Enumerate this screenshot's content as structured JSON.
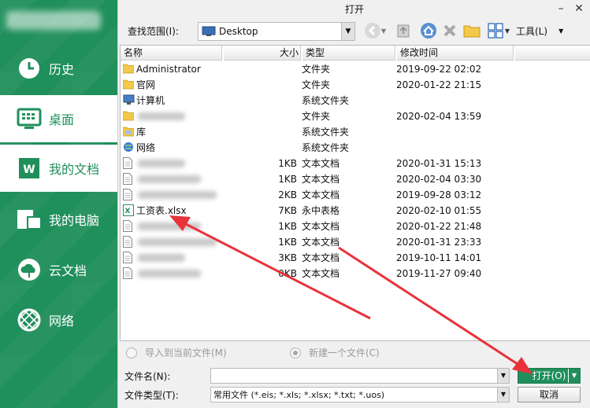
{
  "sidebar": {
    "items": [
      {
        "label": "历史",
        "icon": "clock-icon"
      },
      {
        "label": "桌面",
        "icon": "desktop-icon"
      },
      {
        "label": "我的文档",
        "icon": "documents-icon"
      },
      {
        "label": "我的电脑",
        "icon": "computer-icon"
      },
      {
        "label": "云文档",
        "icon": "cloud-icon"
      },
      {
        "label": "网络",
        "icon": "globe-icon"
      }
    ],
    "active_index": 1
  },
  "dialog": {
    "title": "打开",
    "look_in_label": "查找范围(I):",
    "look_in_value": "Desktop",
    "tools_label": "工具(L)"
  },
  "columns": {
    "name": "名称",
    "size": "大小",
    "type": "类型",
    "date": "修改时间"
  },
  "files": [
    {
      "name": "Administrator",
      "size": "",
      "type": "文件夹",
      "date": "2019-09-22 02:02",
      "icon": "folder-icon"
    },
    {
      "name": "官网",
      "size": "",
      "type": "文件夹",
      "date": "2020-01-22 21:15",
      "icon": "folder-icon"
    },
    {
      "name": "计算机",
      "size": "",
      "type": "系统文件夹",
      "date": "",
      "icon": "computer-icon"
    },
    {
      "name": "",
      "size": "",
      "type": "文件夹",
      "date": "2020-02-04 13:59",
      "icon": "folder-icon",
      "blurred": true
    },
    {
      "name": "库",
      "size": "",
      "type": "系统文件夹",
      "date": "",
      "icon": "library-icon"
    },
    {
      "name": "网络",
      "size": "",
      "type": "系统文件夹",
      "date": "",
      "icon": "network-icon"
    },
    {
      "name": "",
      "size": "1KB",
      "type": "文本文档",
      "date": "2020-01-31 15:13",
      "icon": "text-file-icon",
      "blurred": true
    },
    {
      "name": "",
      "size": "1KB",
      "type": "文本文档",
      "date": "2020-02-04 03:30",
      "icon": "text-file-icon",
      "blurred": true
    },
    {
      "name": "",
      "size": "2KB",
      "type": "文本文档",
      "date": "2019-09-28 03:12",
      "icon": "text-file-icon",
      "blurred": true
    },
    {
      "name": "工资表.xlsx",
      "size": "7KB",
      "type": "永中表格",
      "date": "2020-02-10 01:55",
      "icon": "spreadsheet-icon"
    },
    {
      "name": "",
      "size": "1KB",
      "type": "文本文档",
      "date": "2020-01-22 21:48",
      "icon": "text-file-icon",
      "blurred": true
    },
    {
      "name": "",
      "size": "1KB",
      "type": "文本文档",
      "date": "2020-01-31 23:33",
      "icon": "text-file-icon",
      "blurred": true
    },
    {
      "name": "",
      "size": "3KB",
      "type": "文本文档",
      "date": "2019-10-11 14:01",
      "icon": "text-file-icon",
      "blurred": true
    },
    {
      "name": "",
      "size": "0KB",
      "type": "文本文档",
      "date": "2019-11-27 09:40",
      "icon": "text-file-icon",
      "blurred": true
    }
  ],
  "options": {
    "import_label": "导入到当前文件(M)",
    "new_file_label": "新建一个文件(C)"
  },
  "footer": {
    "filename_label": "文件名(N):",
    "filename_value": "",
    "filetype_label": "文件类型(T):",
    "filetype_value": "常用文件 (*.eis; *.xls; *.xlsx; *.txt; *.uos)",
    "open_label": "打开(O)",
    "cancel_label": "取消"
  },
  "colors": {
    "accent": "#1f8f5b",
    "arrow": "#e8333a"
  }
}
